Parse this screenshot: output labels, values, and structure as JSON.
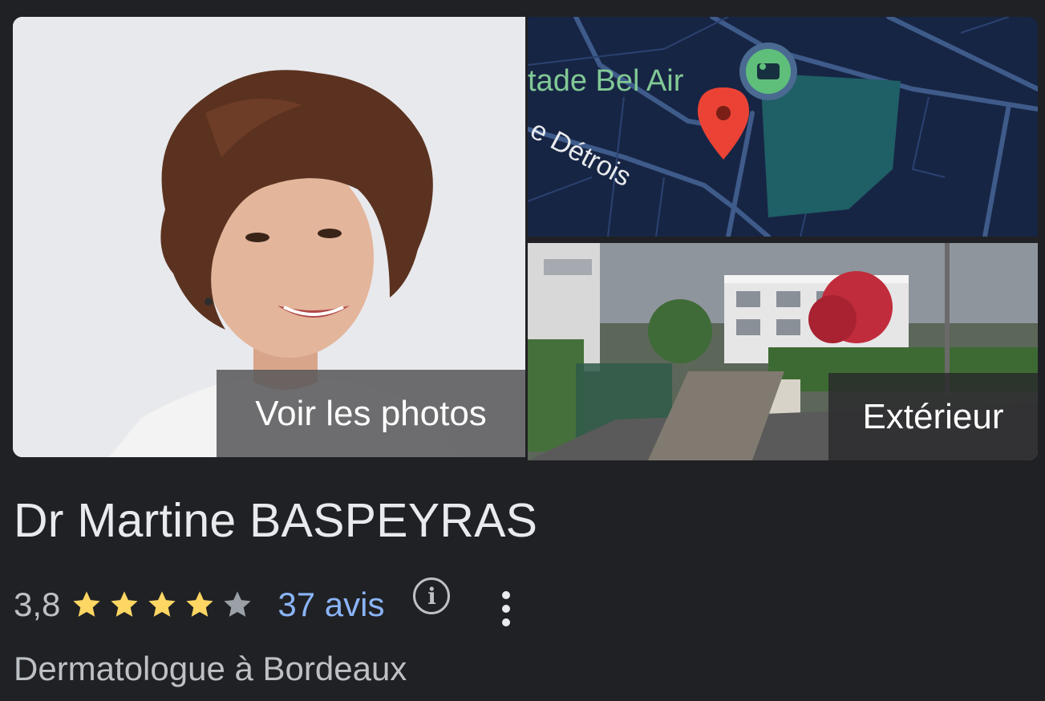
{
  "media": {
    "main_photo_label": "Voir les photos",
    "map": {
      "place_label": "tade Bel Air",
      "street_label": "e Détrois",
      "pin_color": "#ea4335",
      "park_color": "#1f5f66"
    },
    "street_view_label": "Extérieur"
  },
  "business": {
    "name": "Dr Martine BASPEYRAS",
    "rating": "3,8",
    "stars_filled": 4,
    "stars_total": 5,
    "reviews_label": "37 avis",
    "info_icon": "info-icon",
    "more_icon": "more-vert-icon",
    "category": "Dermatologue à Bordeaux"
  },
  "colors": {
    "background": "#202124",
    "star_filled": "#fdd663",
    "star_empty": "#9aa0a6",
    "link": "#8ab4f8"
  }
}
